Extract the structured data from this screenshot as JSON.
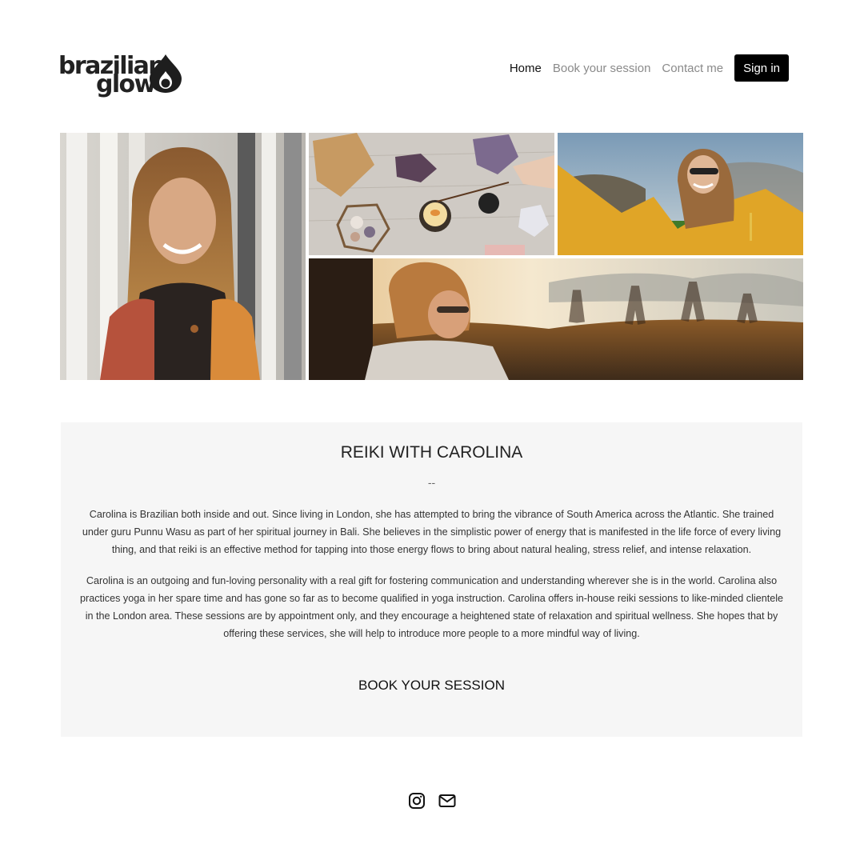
{
  "brand": {
    "name_line1": "brazilian",
    "name_line2": "glow"
  },
  "nav": {
    "items": [
      {
        "label": "Home",
        "active": true
      },
      {
        "label": "Book your session",
        "active": false
      },
      {
        "label": "Contact me",
        "active": false
      }
    ],
    "signin_label": "Sign in"
  },
  "about": {
    "title": "REIKI WITH CAROLINA",
    "divider": "--",
    "paragraphs": [
      "Carolina is Brazilian both inside and out. Since living in London, she has attempted to bring the vibrance of South America across the Atlantic. She trained under guru Punnu Wasu as part of her spiritual journey in Bali. She believes in the simplistic power of energy that is manifested in the life force of every living thing, and that reiki is an effective method for tapping into those energy flows to bring about natural healing, stress relief, and intense relaxation.",
      "Carolina is an outgoing and fun-loving personality with a real gift for fostering communication and understanding wherever she is in the world. Carolina also practices yoga in her spare time and has gone so far as to become qualified in yoga instruction. Carolina offers in-house reiki sessions to like-minded clientele in the London area. These sessions are by appointment only, and they encourage a heightened state of relaxation and spiritual wellness. She hopes that by offering these services, she will help to introduce more people to a more mindful way of living."
    ],
    "cta_label": "BOOK YOUR SESSION"
  },
  "footer": {
    "icons": [
      "instagram-icon",
      "email-icon"
    ]
  },
  "colors": {
    "panel_bg": "#f6f6f6",
    "button_bg": "#000000",
    "nav_inactive": "#8a8a8a"
  }
}
